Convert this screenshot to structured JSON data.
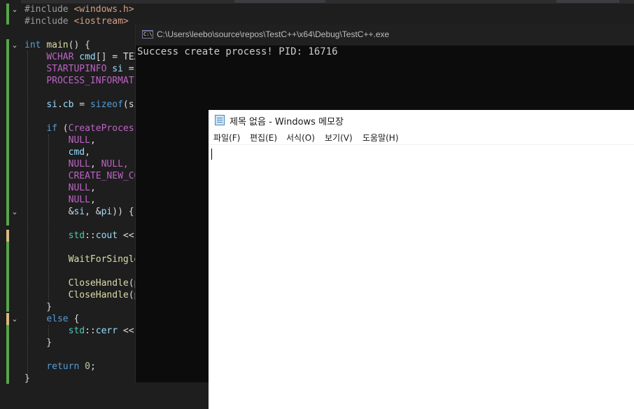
{
  "editor": {
    "lines": [
      [
        {
          "t": "#include ",
          "c": "pp"
        },
        {
          "t": "<windows.h>",
          "c": "str"
        }
      ],
      [
        {
          "t": "#include ",
          "c": "pp"
        },
        {
          "t": "<iostream>",
          "c": "str"
        }
      ],
      [],
      [
        {
          "t": "int",
          "c": "kw"
        },
        {
          "t": " ",
          "c": "pun"
        },
        {
          "t": "main",
          "c": "fn"
        },
        {
          "t": "() {",
          "c": "pun"
        }
      ],
      [
        {
          "t": "    ",
          "c": "pun"
        },
        {
          "t": "WCHAR",
          "c": "mac"
        },
        {
          "t": " ",
          "c": "pun"
        },
        {
          "t": "cmd",
          "c": "var"
        },
        {
          "t": "[] = TEX",
          "c": "pun"
        }
      ],
      [
        {
          "t": "    ",
          "c": "pun"
        },
        {
          "t": "STARTUPINFO",
          "c": "mac"
        },
        {
          "t": " ",
          "c": "pun"
        },
        {
          "t": "si",
          "c": "var"
        },
        {
          "t": " =",
          "c": "pun"
        }
      ],
      [
        {
          "t": "    ",
          "c": "pun"
        },
        {
          "t": "PROCESS_INFORMATI",
          "c": "mac"
        }
      ],
      [],
      [
        {
          "t": "    ",
          "c": "pun"
        },
        {
          "t": "si",
          "c": "var"
        },
        {
          "t": ".",
          "c": "pun"
        },
        {
          "t": "cb",
          "c": "var"
        },
        {
          "t": " = ",
          "c": "pun"
        },
        {
          "t": "sizeof",
          "c": "kw"
        },
        {
          "t": "(si",
          "c": "pun"
        }
      ],
      [],
      [
        {
          "t": "    ",
          "c": "pun"
        },
        {
          "t": "if",
          "c": "kw"
        },
        {
          "t": " (",
          "c": "pun"
        },
        {
          "t": "CreateProcess",
          "c": "mac"
        }
      ],
      [
        {
          "t": "        ",
          "c": "pun"
        },
        {
          "t": "NULL",
          "c": "mac"
        },
        {
          "t": ",",
          "c": "pun"
        }
      ],
      [
        {
          "t": "        ",
          "c": "pun"
        },
        {
          "t": "cmd",
          "c": "var"
        },
        {
          "t": ",",
          "c": "pun"
        }
      ],
      [
        {
          "t": "        ",
          "c": "pun"
        },
        {
          "t": "NULL",
          "c": "mac"
        },
        {
          "t": ", ",
          "c": "pun"
        },
        {
          "t": "NULL",
          "c": "mac"
        },
        {
          "t": ", F",
          "c": "mac"
        }
      ],
      [
        {
          "t": "        ",
          "c": "pun"
        },
        {
          "t": "CREATE_NEW_CO",
          "c": "mac"
        }
      ],
      [
        {
          "t": "        ",
          "c": "pun"
        },
        {
          "t": "NULL",
          "c": "mac"
        },
        {
          "t": ",",
          "c": "pun"
        }
      ],
      [
        {
          "t": "        ",
          "c": "pun"
        },
        {
          "t": "NULL",
          "c": "mac"
        },
        {
          "t": ",",
          "c": "pun"
        }
      ],
      [
        {
          "t": "        ",
          "c": "pun"
        },
        {
          "t": "&",
          "c": "pun"
        },
        {
          "t": "si",
          "c": "var"
        },
        {
          "t": ", &",
          "c": "pun"
        },
        {
          "t": "pi",
          "c": "var"
        },
        {
          "t": ")) {",
          "c": "pun"
        }
      ],
      [],
      [
        {
          "t": "        ",
          "c": "pun"
        },
        {
          "t": "std",
          "c": "typ"
        },
        {
          "t": "::",
          "c": "pun"
        },
        {
          "t": "cout",
          "c": "var"
        },
        {
          "t": " <<",
          "c": "pun"
        }
      ],
      [],
      [
        {
          "t": "        ",
          "c": "pun"
        },
        {
          "t": "WaitForSingle",
          "c": "fn"
        }
      ],
      [],
      [
        {
          "t": "        ",
          "c": "pun"
        },
        {
          "t": "CloseHandle",
          "c": "fn"
        },
        {
          "t": "(p",
          "c": "pun"
        }
      ],
      [
        {
          "t": "        ",
          "c": "pun"
        },
        {
          "t": "CloseHandle",
          "c": "fn"
        },
        {
          "t": "(p",
          "c": "pun"
        }
      ],
      [
        {
          "t": "    }",
          "c": "pun"
        }
      ],
      [
        {
          "t": "    ",
          "c": "pun"
        },
        {
          "t": "else",
          "c": "kw"
        },
        {
          "t": " {",
          "c": "pun"
        }
      ],
      [
        {
          "t": "        ",
          "c": "pun"
        },
        {
          "t": "std",
          "c": "typ"
        },
        {
          "t": "::",
          "c": "pun"
        },
        {
          "t": "cerr",
          "c": "var"
        },
        {
          "t": " <<",
          "c": "pun"
        }
      ],
      [
        {
          "t": "    }",
          "c": "pun"
        }
      ],
      [],
      [
        {
          "t": "    ",
          "c": "pun"
        },
        {
          "t": "return",
          "c": "kw"
        },
        {
          "t": " ",
          "c": "pun"
        },
        {
          "t": "0",
          "c": "num"
        },
        {
          "t": ";",
          "c": "pun"
        }
      ],
      [
        {
          "t": "}",
          "c": "pun"
        }
      ]
    ]
  },
  "console": {
    "title": "C:\\Users\\leebo\\source\\repos\\TestC++\\x64\\Debug\\TestC++.exe",
    "icon_text": "C:\\",
    "output": "Success create process! PID: 16716"
  },
  "notepad": {
    "title": "제목 없음 - Windows 메모장",
    "menu": [
      "파일(F)",
      "편집(E)",
      "서식(O)",
      "보기(V)",
      "도움말(H)"
    ],
    "content": ""
  }
}
